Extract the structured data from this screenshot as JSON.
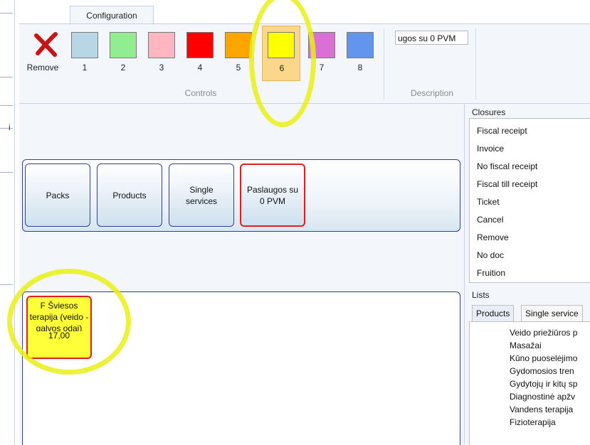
{
  "ribbon": {
    "tab_label": "Configuration",
    "remove_label": "Remove",
    "color_controls": [
      {
        "label": "1",
        "color": "#b7d6e6"
      },
      {
        "label": "2",
        "color": "#90ee90"
      },
      {
        "label": "3",
        "color": "#ffb6c1"
      },
      {
        "label": "4",
        "color": "#ff0000"
      },
      {
        "label": "5",
        "color": "#ffa500"
      },
      {
        "label": "6",
        "color": "#ffff00",
        "selected": true
      },
      {
        "label": "7",
        "color": "#da70d6"
      },
      {
        "label": "8",
        "color": "#6495ed"
      }
    ],
    "controls_group_label": "Controls",
    "description_value": "ugos su 0 PVM",
    "description_group_label": "Description"
  },
  "categories": [
    {
      "label": "Packs",
      "active": false
    },
    {
      "label": "Products",
      "active": false
    },
    {
      "label": "Single services",
      "active": false
    },
    {
      "label": "Paslaugos su 0 PVM",
      "active": true
    }
  ],
  "product": {
    "name": "F Šviesos terapija (veido - galvos odai)",
    "price": "17,00",
    "color": "#ffff3a"
  },
  "closures": {
    "title": "Closures",
    "items": [
      "Fiscal receipt",
      "Invoice",
      "No fiscal receipt",
      "Fiscal till receipt",
      "Ticket",
      "Cancel",
      "Remove",
      "No doc",
      "Fruition"
    ]
  },
  "lists": {
    "title": "Lists",
    "tabs": [
      "Products",
      "Single service"
    ],
    "items": [
      "Veido priežiūros p",
      "Masažai",
      "Kūno puoselėjimo",
      "Gydomosios tren",
      "Gydytojų ir kitų sp",
      "Diagnostinė apžv",
      "Vandens terapija",
      "Fizioterapija"
    ]
  },
  "left_strip_char": "i"
}
